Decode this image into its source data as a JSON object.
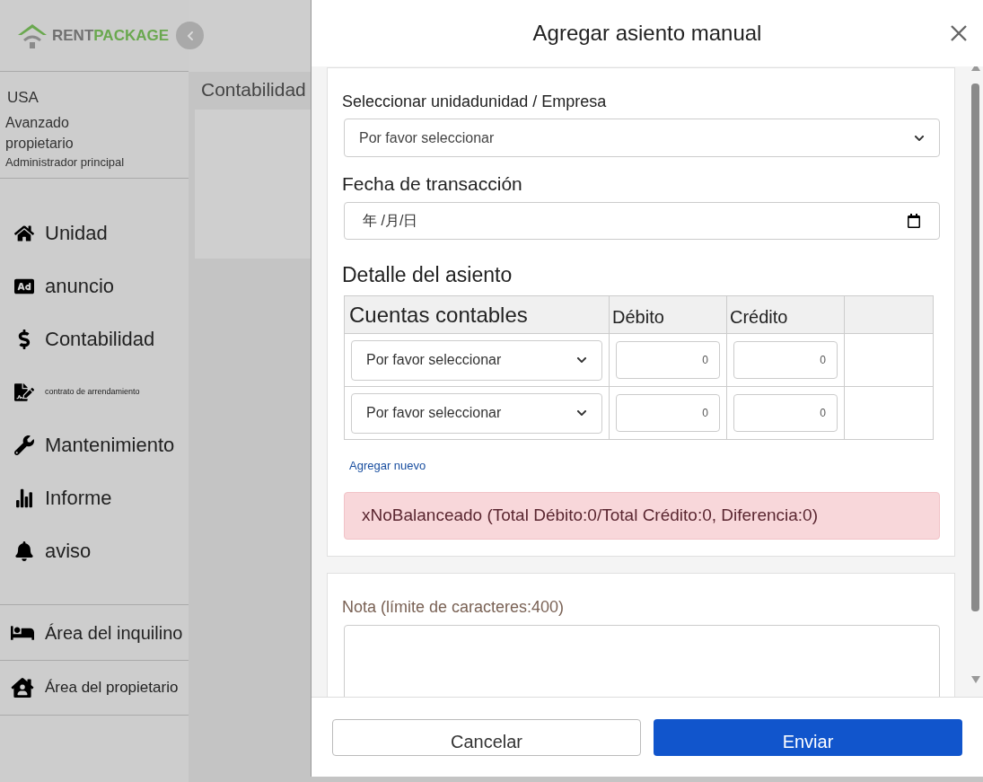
{
  "sidebar": {
    "logo": {
      "part1": "RENT",
      "part2": "PACKAGE"
    },
    "user": {
      "country": "USA",
      "plan": "Avanzado propietario",
      "role": "Administrador principal"
    },
    "nav": [
      {
        "label": "Unidad",
        "kind": "normal"
      },
      {
        "label": "anuncio",
        "kind": "normal"
      },
      {
        "label": "Contabilidad",
        "kind": "normal"
      },
      {
        "label": "contrato de arrendamiento",
        "kind": "compact"
      },
      {
        "label": "Mantenimiento",
        "kind": "normal"
      },
      {
        "label": "Informe",
        "kind": "normal"
      },
      {
        "label": "aviso",
        "kind": "normal"
      }
    ],
    "areas": [
      {
        "label": "Área del inquilino"
      },
      {
        "label": "Área del propietario"
      }
    ]
  },
  "main": {
    "page_title": "Contabilidad"
  },
  "modal": {
    "title": "Agregar asiento manual",
    "unit": {
      "label": "Seleccionar unidadunidad / Empresa",
      "value": "Por favor seleccionar"
    },
    "date": {
      "label": "Fecha de transacción",
      "placeholder": "年 /月/日"
    },
    "detail": {
      "title": "Detalle del asiento",
      "columns": [
        "Cuentas contables",
        "Débito",
        "Crédito"
      ],
      "rows": [
        {
          "account": "Por favor seleccionar",
          "debit": "0",
          "credit": "0"
        },
        {
          "account": "Por favor seleccionar",
          "debit": "0",
          "credit": "0"
        }
      ],
      "add_link": "Agregar nuevo",
      "alert": "xNoBalanceado (Total Débito:0/Total Crédito:0, Diferencia:0)"
    },
    "note": {
      "label": "Nota (límite de caracteres:400)"
    },
    "buttons": {
      "cancel": "Cancelar",
      "submit": "Enviar"
    }
  }
}
